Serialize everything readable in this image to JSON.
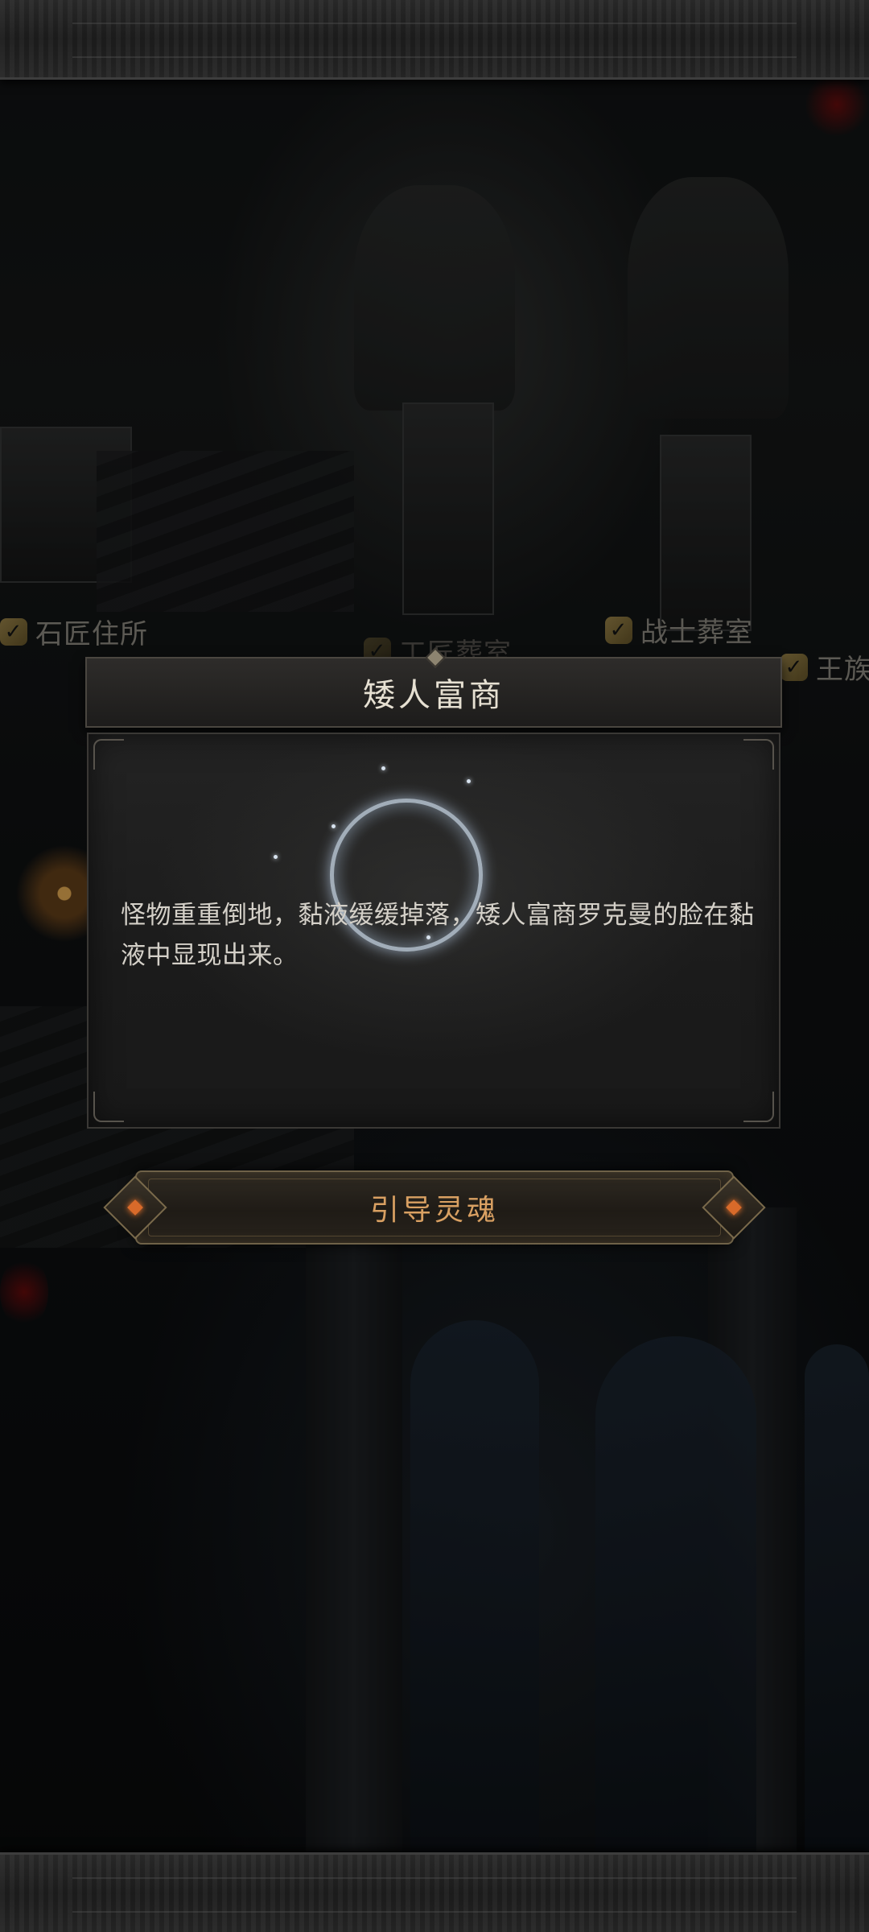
{
  "locations": [
    {
      "label": "石匠住所"
    },
    {
      "label": "工匠葬室"
    },
    {
      "label": "战士葬室"
    },
    {
      "label": "王族"
    }
  ],
  "dialog": {
    "title": "矮人富商",
    "text": "怪物重重倒地，黏液缓缓掉落，矮人富商罗克曼的脸在黏液中显现出来。"
  },
  "action": {
    "label": "引导灵魂"
  },
  "icons": {
    "location_marker": "check-icon",
    "orb": "soul-orb",
    "button_caps": "diamond-gem-icon"
  },
  "colors": {
    "title_text": "#e6e0d2",
    "body_text": "#d4d0c8",
    "button_text": "#d9a062",
    "gem": "#d86a2a"
  }
}
